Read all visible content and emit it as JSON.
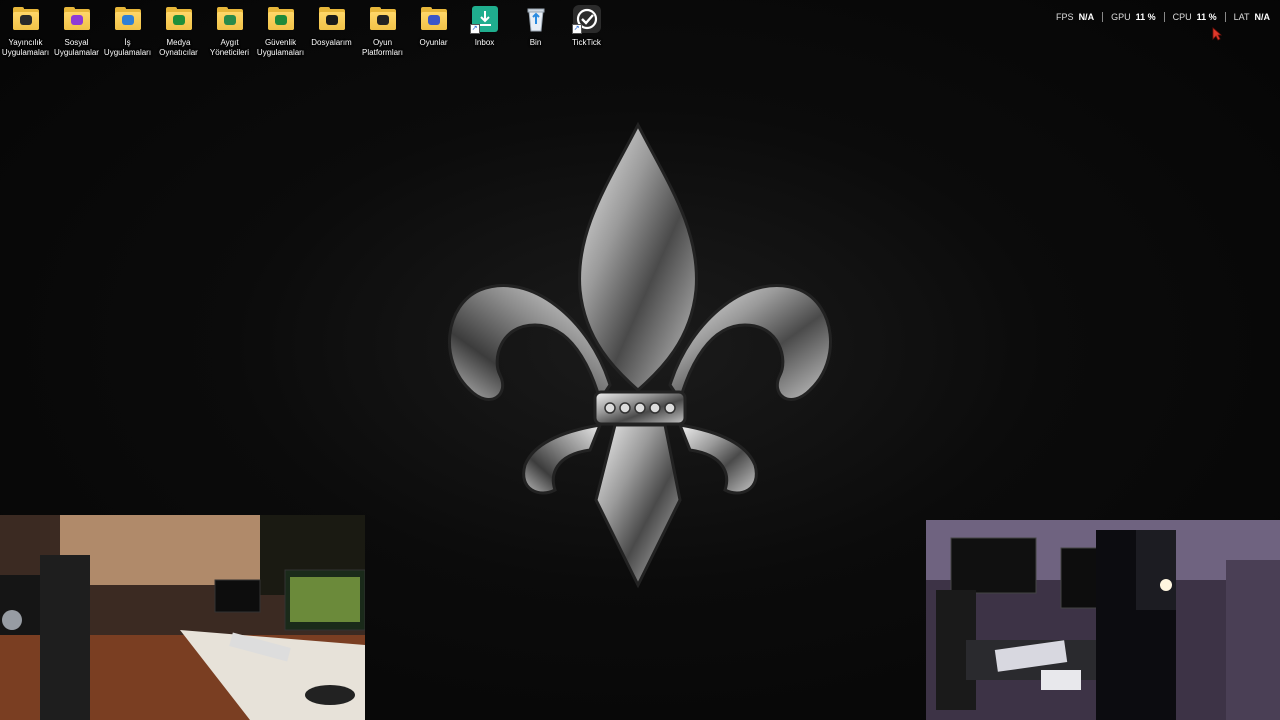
{
  "desktop": {
    "icons": [
      {
        "name": "yayincilik-uygulamalari-folder",
        "type": "folder",
        "emblem_color": "#2a2a2a",
        "label": "Yayıncılık\nUygulamaları"
      },
      {
        "name": "sosyal-uygulamalar-folder",
        "type": "folder",
        "emblem_color": "#8e3bd6",
        "label": "Sosyal\nUygulamalar"
      },
      {
        "name": "is-uygulamalari-folder",
        "type": "folder",
        "emblem_color": "#2f7fd6",
        "label": "İş\nUygulamaları"
      },
      {
        "name": "medya-oynaticilar-folder",
        "type": "folder",
        "emblem_color": "#1f8f3a",
        "label": "Medya\nOynatıcılar"
      },
      {
        "name": "aygit-yoneticileri-folder",
        "type": "folder",
        "emblem_color": "#2a8a4a",
        "label": "Aygıt\nYöneticileri"
      },
      {
        "name": "guvenlik-uygulamalari-folder",
        "type": "folder",
        "emblem_color": "#1f8a3a",
        "label": "Güvenlik\nUygulamaları"
      },
      {
        "name": "dosyalarim-folder",
        "type": "folder",
        "emblem_color": "#1a1a1a",
        "label": "Dosyalarım"
      },
      {
        "name": "oyun-platformlari-folder",
        "type": "folder",
        "emblem_color": "#222222",
        "label": "Oyun\nPlatformları"
      },
      {
        "name": "oyunlar-folder",
        "type": "folder",
        "emblem_color": "#3a55c8",
        "label": "Oyunlar"
      },
      {
        "name": "inbox-shortcut",
        "type": "app",
        "color": "#1fa88a",
        "label": "Inbox"
      },
      {
        "name": "recycle-bin",
        "type": "bin",
        "label": "Bin"
      },
      {
        "name": "ticktick-shortcut",
        "type": "app",
        "color": "#2a2a2a",
        "label": "TickTick"
      }
    ]
  },
  "perf_overlay": {
    "items": [
      {
        "key": "FPS",
        "value": "N/A"
      },
      {
        "key": "GPU",
        "value": "11 %"
      },
      {
        "key": "CPU",
        "value": "11 %"
      },
      {
        "key": "LAT",
        "value": "N/A"
      }
    ]
  },
  "wallpaper": {
    "icon": "fleur-de-lis-icon"
  }
}
